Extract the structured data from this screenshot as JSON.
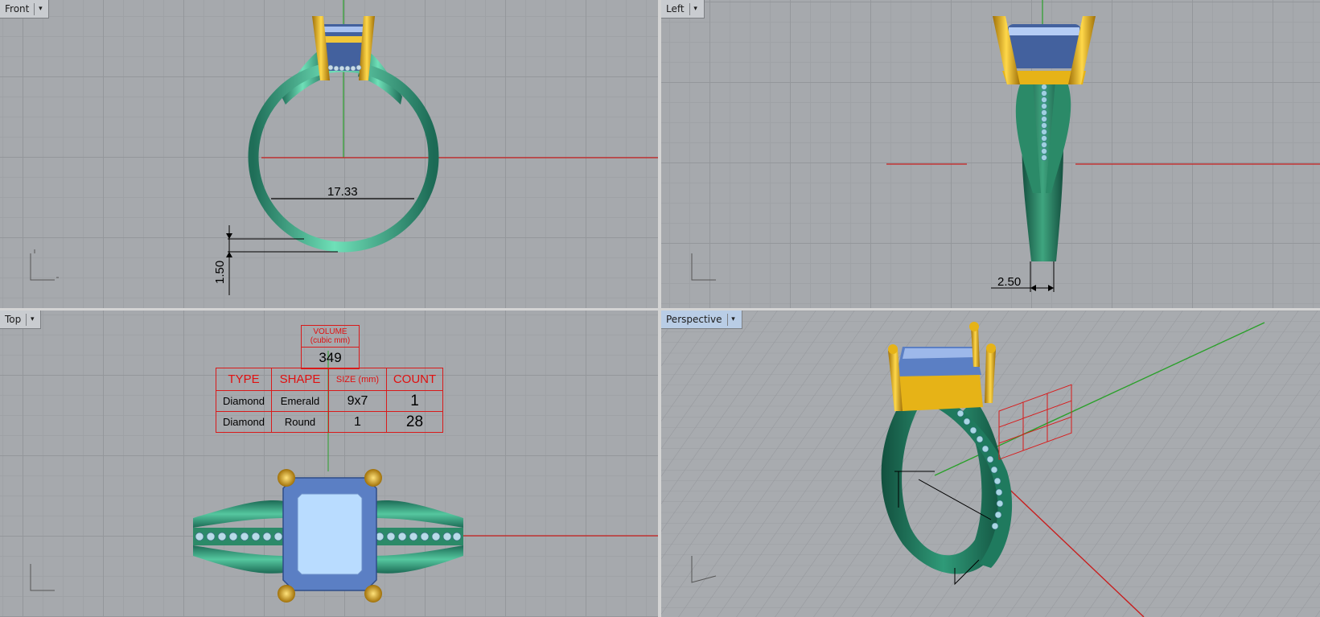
{
  "viewports": {
    "front": {
      "title": "Front"
    },
    "left": {
      "title": "Left"
    },
    "top": {
      "title": "Top"
    },
    "perspective": {
      "title": "Perspective"
    }
  },
  "dimensions": {
    "inner_diameter": "17.33",
    "shank_thickness": "1.50",
    "shank_width": "2.50"
  },
  "volume": {
    "label_line1": "VOLUME",
    "label_line2": "(cubic mm)",
    "value": "349"
  },
  "stone_table": {
    "headers": [
      "TYPE",
      "SHAPE",
      "SIZE (mm)",
      "COUNT"
    ],
    "rows": [
      [
        "Diamond",
        "Emerald",
        "9x7",
        "1"
      ],
      [
        "Diamond",
        "Round",
        "1",
        "28"
      ]
    ]
  },
  "colors": {
    "metal_green": "#2f9a78",
    "gold": "#e6b317",
    "stone_blue": "#5b7fc4",
    "axis_red": "#c81e1e",
    "axis_green": "#2aa02a",
    "viewport_bg": "#a6a9ad"
  }
}
